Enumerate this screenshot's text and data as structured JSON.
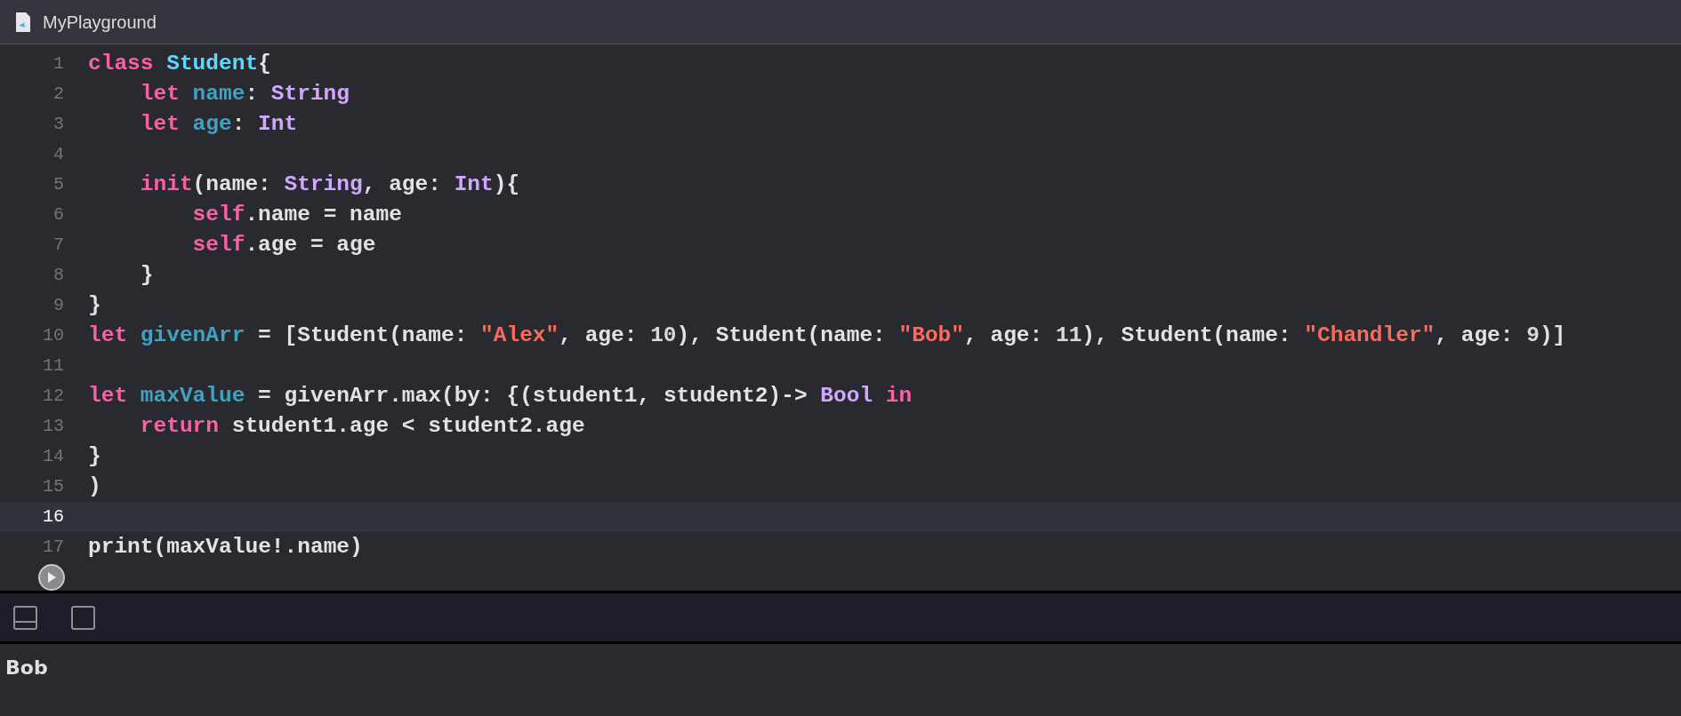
{
  "window": {
    "title": "MyPlayground"
  },
  "editor": {
    "lines": [
      {
        "number": "1",
        "current": false,
        "kind": "top",
        "tokens": [
          {
            "kind": "keyword",
            "text": "class"
          },
          {
            "kind": "decl",
            "text": "Student",
            "gap": true
          },
          {
            "kind": "plain",
            "text": "{"
          }
        ]
      },
      {
        "number": "2",
        "current": false,
        "kind": "member",
        "tokens": [
          {
            "kind": "keyword",
            "text": "let"
          },
          {
            "kind": "ident",
            "text": "name",
            "gap": true
          },
          {
            "kind": "plain",
            "text": ":"
          },
          {
            "kind": "type",
            "text": "String",
            "gap": true
          }
        ]
      },
      {
        "number": "3",
        "current": false,
        "kind": "member",
        "tokens": [
          {
            "kind": "keyword",
            "text": "let"
          },
          {
            "kind": "ident",
            "text": "age",
            "gap": true
          },
          {
            "kind": "plain",
            "text": ":"
          },
          {
            "kind": "type",
            "text": "Int",
            "gap": true
          }
        ]
      },
      {
        "number": "4",
        "current": false
      },
      {
        "number": "5",
        "current": false,
        "kind": "member",
        "tokens": [
          {
            "kind": "keyword",
            "text": "init"
          },
          {
            "kind": "plain",
            "text": "(name:"
          },
          {
            "kind": "type",
            "text": "String",
            "gap": true
          },
          {
            "kind": "plain",
            "text": ", age:"
          },
          {
            "kind": "type",
            "text": "Int",
            "gap": true
          },
          {
            "kind": "plain",
            "text": "){"
          }
        ]
      },
      {
        "number": "6",
        "current": false,
        "kind": "inner",
        "tokens": [
          {
            "kind": "keyword",
            "text": "self"
          },
          {
            "kind": "plain",
            "text": ".name = name"
          }
        ]
      },
      {
        "number": "7",
        "current": false,
        "kind": "inner",
        "tokens": [
          {
            "kind": "keyword",
            "text": "self"
          },
          {
            "kind": "plain",
            "text": ".age = age"
          }
        ]
      },
      {
        "number": "8",
        "current": false,
        "kind": "member",
        "tokens": [
          {
            "kind": "plain",
            "text": "}"
          }
        ]
      },
      {
        "number": "9",
        "current": false,
        "kind": "top",
        "tokens": [
          {
            "kind": "plain",
            "text": "}"
          }
        ]
      },
      {
        "number": "10",
        "current": false,
        "kind": "top",
        "tokens": [
          {
            "kind": "keyword",
            "text": "let"
          },
          {
            "kind": "ident",
            "text": "givenArr",
            "gap": true
          },
          {
            "kind": "plain",
            "text": "= [Student(name:",
            "gap": true
          },
          {
            "kind": "string",
            "text": "\"Alex\"",
            "gap": true
          },
          {
            "kind": "plain",
            "text": ", age:"
          },
          {
            "kind": "number",
            "text": "10",
            "gap": true
          },
          {
            "kind": "plain",
            "text": "), Student(name:"
          },
          {
            "kind": "string",
            "text": "\"Bob\"",
            "gap": true
          },
          {
            "kind": "plain",
            "text": ", age:"
          },
          {
            "kind": "number",
            "text": "11",
            "gap": true
          },
          {
            "kind": "plain",
            "text": "), Student(name:"
          },
          {
            "kind": "string",
            "text": "\"Chandler\"",
            "gap": true
          },
          {
            "kind": "plain",
            "text": ", age:"
          },
          {
            "kind": "number",
            "text": "9",
            "gap": true
          },
          {
            "kind": "plain",
            "text": ")]"
          }
        ]
      },
      {
        "number": "11",
        "current": false
      },
      {
        "number": "12",
        "current": false,
        "kind": "top",
        "tokens": [
          {
            "kind": "keyword",
            "text": "let"
          },
          {
            "kind": "ident",
            "text": "maxValue",
            "gap": true
          },
          {
            "kind": "plain",
            "text": "= givenArr.max(by: {(student1, student2)->",
            "gap": true
          },
          {
            "kind": "type",
            "text": "Bool",
            "gap": true
          },
          {
            "kind": "keyword",
            "text": "in",
            "gap": true
          }
        ]
      },
      {
        "number": "13",
        "current": false,
        "kind": "member",
        "tokens": [
          {
            "kind": "keyword",
            "text": "return"
          },
          {
            "kind": "plain",
            "text": "student1.age < student2.age",
            "gap": true
          }
        ]
      },
      {
        "number": "14",
        "current": false,
        "kind": "top",
        "tokens": [
          {
            "kind": "plain",
            "text": "}"
          }
        ]
      },
      {
        "number": "15",
        "current": false,
        "kind": "top",
        "tokens": [
          {
            "kind": "plain",
            "text": ")"
          }
        ]
      },
      {
        "number": "16",
        "current": true
      },
      {
        "number": "17",
        "current": false,
        "kind": "top",
        "tokens": [
          {
            "kind": "plain",
            "text": "print(maxValue!.name)"
          }
        ]
      }
    ]
  },
  "console": {
    "output": "Bob"
  }
}
